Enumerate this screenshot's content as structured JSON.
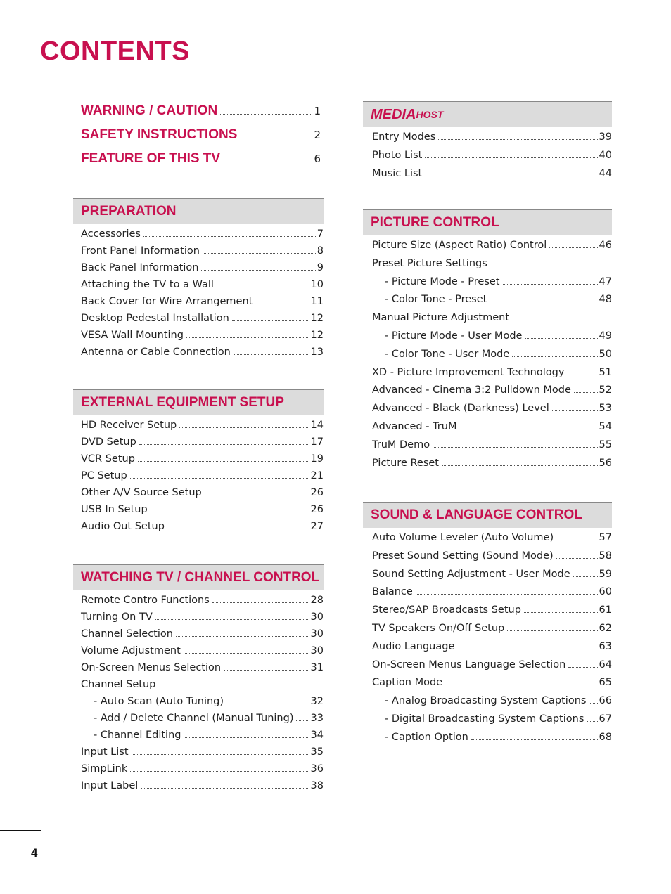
{
  "page": {
    "title": "CONTENTS",
    "page_number": "4",
    "accent_color": "#c8104f"
  },
  "top_entries": [
    {
      "label": "WARNING / CAUTION",
      "page": "1"
    },
    {
      "label": "SAFETY INSTRUCTIONS",
      "page": "2"
    },
    {
      "label": "FEATURE OF THIS TV",
      "page": "6"
    }
  ],
  "sections": {
    "preparation": {
      "title": "PREPARATION",
      "items": [
        {
          "label": "Accessories",
          "page": "7"
        },
        {
          "label": "Front Panel Information",
          "page": "8"
        },
        {
          "label": "Back Panel Information",
          "page": "9"
        },
        {
          "label": "Attaching the TV to a Wall",
          "page": "10"
        },
        {
          "label": "Back Cover for Wire Arrangement",
          "page": "11"
        },
        {
          "label": "Desktop Pedestal Installation",
          "page": "12"
        },
        {
          "label": "VESA Wall Mounting",
          "page": "12"
        },
        {
          "label": "Antenna or Cable Connection",
          "page": "13"
        }
      ]
    },
    "external": {
      "title": "EXTERNAL EQUIPMENT SETUP",
      "items": [
        {
          "label": "HD Receiver Setup",
          "page": "14"
        },
        {
          "label": "DVD Setup",
          "page": "17"
        },
        {
          "label": "VCR Setup",
          "page": "19"
        },
        {
          "label": "PC Setup",
          "page": "21"
        },
        {
          "label": "Other A/V Source Setup",
          "page": "26"
        },
        {
          "label": "USB In Setup",
          "page": "26"
        },
        {
          "label": "Audio Out Setup",
          "page": "27"
        }
      ]
    },
    "watching": {
      "title": "WATCHING TV / CHANNEL CONTROL",
      "items": [
        {
          "label": "Remote Contro Functions",
          "page": "28"
        },
        {
          "label": "Turning On TV",
          "page": "30"
        },
        {
          "label": "Channel Selection",
          "page": "30"
        },
        {
          "label": "Volume Adjustment",
          "page": "30"
        },
        {
          "label": "On-Screen Menus Selection",
          "page": "31"
        },
        {
          "label": "Channel Setup",
          "page": ""
        },
        {
          "label": "- Auto Scan (Auto Tuning)",
          "page": "32",
          "sub": true
        },
        {
          "label": "- Add / Delete Channel (Manual Tuning)",
          "page": "33",
          "sub": true
        },
        {
          "label": "- Channel Editing",
          "page": "34",
          "sub": true
        },
        {
          "label": "Input List",
          "page": "35"
        },
        {
          "label": "SimpLink",
          "page": "36"
        },
        {
          "label": "Input Label",
          "page": "38"
        }
      ]
    },
    "mediahost": {
      "title_main": "MEDIA",
      "title_small": "HOST",
      "items": [
        {
          "label": "Entry Modes",
          "page": "39"
        },
        {
          "label": "Photo List",
          "page": "40"
        },
        {
          "label": "Music List",
          "page": "44"
        }
      ]
    },
    "picture": {
      "title": "PICTURE CONTROL",
      "items": [
        {
          "label": "Picture Size (Aspect Ratio) Control",
          "page": "46"
        },
        {
          "label": "Preset Picture Settings",
          "page": ""
        },
        {
          "label": "- Picture Mode - Preset",
          "page": "47",
          "sub": true
        },
        {
          "label": "- Color Tone - Preset",
          "page": "48",
          "sub": true
        },
        {
          "label": "Manual Picture Adjustment",
          "page": ""
        },
        {
          "label": "- Picture Mode - User Mode",
          "page": "49",
          "sub": true
        },
        {
          "label": "- Color Tone - User Mode",
          "page": "50",
          "sub": true
        },
        {
          "label": "XD - Picture Improvement Technology",
          "page": "51"
        },
        {
          "label": "Advanced - Cinema 3:2 Pulldown Mode",
          "page": "52"
        },
        {
          "label": "Advanced - Black (Darkness) Level",
          "page": "53"
        },
        {
          "label": "Advanced - TruM",
          "page": "54"
        },
        {
          "label": "TruM Demo",
          "page": "55"
        },
        {
          "label": "Picture Reset",
          "page": "56"
        }
      ]
    },
    "sound": {
      "title": "SOUND & LANGUAGE CONTROL",
      "items": [
        {
          "label": "Auto Volume Leveler (Auto Volume)",
          "page": "57"
        },
        {
          "label": "Preset Sound Setting (Sound Mode)",
          "page": "58"
        },
        {
          "label": "Sound Setting Adjustment - User Mode",
          "page": "59"
        },
        {
          "label": "Balance",
          "page": "60"
        },
        {
          "label": "Stereo/SAP Broadcasts Setup",
          "page": "61"
        },
        {
          "label": "TV Speakers On/Off Setup",
          "page": "62"
        },
        {
          "label": "Audio Language",
          "page": "63"
        },
        {
          "label": "On-Screen Menus Language Selection",
          "page": "64"
        },
        {
          "label": "Caption Mode",
          "page": "65"
        },
        {
          "label": "- Analog Broadcasting System Captions",
          "page": "66",
          "sub": true
        },
        {
          "label": "- Digital Broadcasting System Captions",
          "page": "67",
          "sub": true
        },
        {
          "label": "- Caption Option",
          "page": "68",
          "sub": true
        }
      ]
    }
  }
}
